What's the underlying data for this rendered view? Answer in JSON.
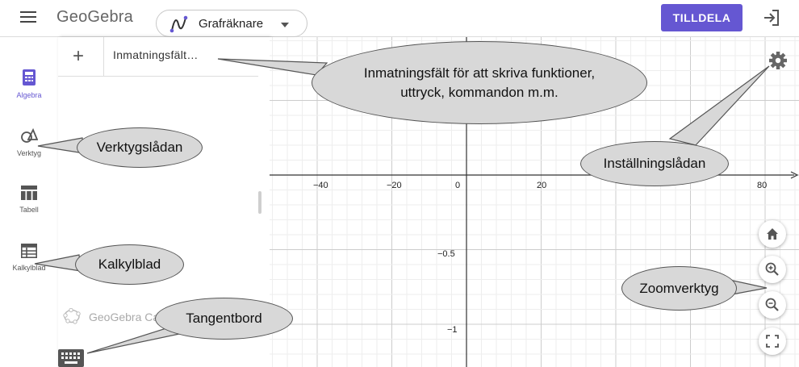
{
  "topbar": {
    "logo": "GeoGebra",
    "app_name": "Grafräknare",
    "assign_label": "TILLDELA"
  },
  "sidebar": {
    "items": [
      {
        "label": "Algebra",
        "icon": "calculator-icon",
        "active": true
      },
      {
        "label": "Verktyg",
        "icon": "tools-icon",
        "active": false
      },
      {
        "label": "Tabell",
        "icon": "table-icon",
        "active": false
      },
      {
        "label": "Kalkylblad",
        "icon": "spreadsheet-icon",
        "active": false
      }
    ]
  },
  "algebra": {
    "input_placeholder": "Inmatningsfält…",
    "brand_text": "GeoGebra Ca"
  },
  "graph": {
    "x_ticks": [
      "−40",
      "−20",
      "0",
      "20",
      "80"
    ],
    "y_ticks": [
      "−0.5",
      "−1"
    ]
  },
  "callouts": {
    "input": "Inmatningsfält för att skriva funktioner, uttryck, kommandon m.m.",
    "tools": "Verktygslådan",
    "settings": "Inställningslådan",
    "spreadsheet": "Kalkylblad",
    "zoom": "Zoomverktyg",
    "keyboard": "Tangentbord"
  },
  "colors": {
    "accent": "#6557d2",
    "callout_fill": "#d8d8d8",
    "grid_minor": "#eeeeee",
    "grid_major": "#cccccc"
  }
}
